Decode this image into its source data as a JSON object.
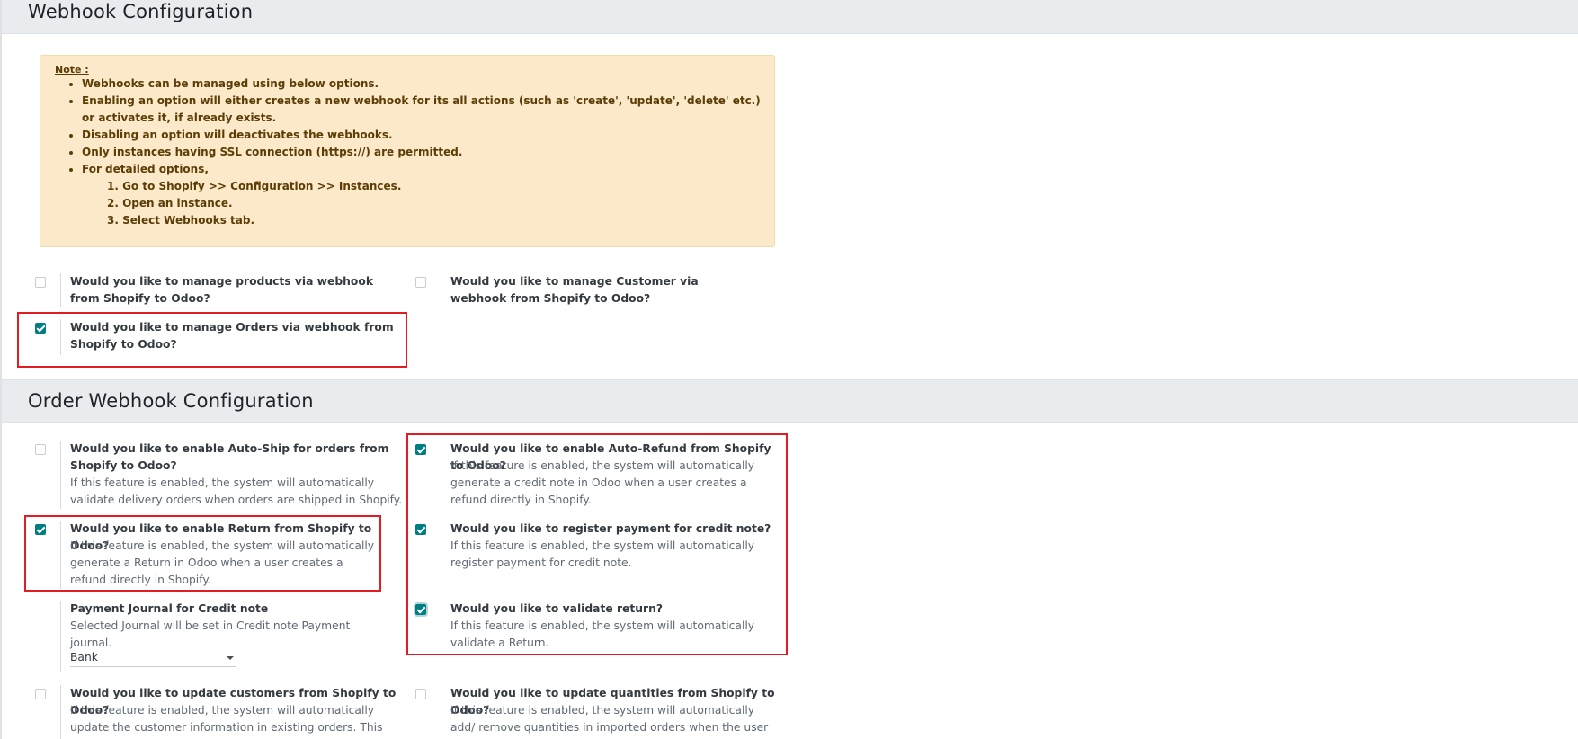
{
  "webhook_section": {
    "title": "Webhook Configuration"
  },
  "note": {
    "title": "Note :",
    "bullets": [
      "Webhooks can be managed using below options.",
      "Enabling an option will either creates a new webhook for its all actions (such as 'create', 'update', 'delete' etc.) or activates it, if already exists.",
      "Disabling an option will deactivates the webhooks.",
      "Only instances having SSL connection (https://) are permitted.",
      "For detailed options,"
    ],
    "steps": [
      "1. Go to Shopify >> Configuration >> Instances.",
      "2. Open an instance.",
      "3. Select Webhooks tab."
    ]
  },
  "webhook_options": {
    "products": {
      "label": "Would you like to manage products via webhook from Shopify to Odoo?",
      "checked": false
    },
    "customer": {
      "label": "Would you like to manage Customer via webhook from Shopify to Odoo?",
      "checked": false
    },
    "orders": {
      "label": "Would you like to manage Orders via webhook from Shopify to Odoo?",
      "checked": true
    }
  },
  "order_section": {
    "title": "Order Webhook Configuration"
  },
  "order_options": {
    "auto_ship": {
      "label": "Would you like to enable Auto-Ship for orders from Shopify to Odoo?",
      "desc": "If this feature is enabled, the system will automatically validate delivery orders when orders are shipped in Shopify.",
      "checked": false
    },
    "auto_refund": {
      "label": "Would you like to enable Auto-Refund from Shopify to Odoo?",
      "desc": "If this feature is enabled, the system will automatically generate a credit note in Odoo when a user creates a refund directly in Shopify.",
      "checked": true
    },
    "return": {
      "label": "Would you like to enable Return from Shopify to Odoo?",
      "desc": "If this feature is enabled, the system will automatically generate a Return in Odoo when a user creates a refund directly in Shopify.",
      "checked": true
    },
    "register_payment": {
      "label": "Would you like to register payment for credit note?",
      "desc": "If this feature is enabled, the system will automatically register payment for credit note.",
      "checked": true
    },
    "payment_journal": {
      "label": "Payment Journal for Credit note",
      "desc": "Selected Journal will be set in Credit note Payment journal.",
      "value": "Bank"
    },
    "validate_return": {
      "label": "Would you like to validate return?",
      "desc": "If this feature is enabled, the system will automatically validate a Return.",
      "checked": true
    },
    "update_customers": {
      "label": "Would you like to update customers from Shopify to Odoo?",
      "desc": "If this feature is enabled, the system will automatically update the customer information in existing orders. This feature is not",
      "checked": false
    },
    "update_quantities": {
      "label": "Would you like to update quantities from Shopify to Odoo?",
      "desc": "If this feature is enabled, the system will automatically add/ remove quantities in imported orders when the user manually",
      "checked": false
    }
  },
  "colors": {
    "accent": "#017e84",
    "highlight": "#e31b23",
    "note_bg": "#fbe9c9",
    "header_bg": "#e9ecef"
  }
}
